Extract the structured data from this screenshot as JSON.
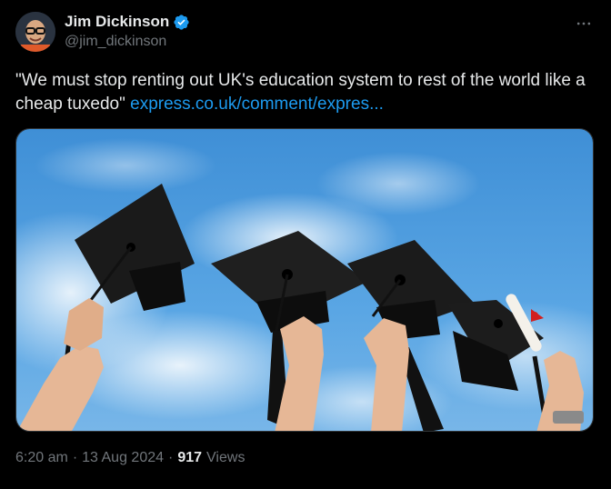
{
  "author": {
    "display_name": "Jim Dickinson",
    "handle": "@jim_dickinson",
    "verified": true
  },
  "tweet": {
    "text": "\"We must stop renting out UK's education system to rest of the world like a cheap tuxedo\" ",
    "link_text": "express.co.uk/comment/expres...",
    "media_description": "Graduation caps thrown against blue sky"
  },
  "meta": {
    "time": "6:20 am",
    "separator": "·",
    "date": "13 Aug 2024",
    "views_count": "917",
    "views_label": "Views"
  },
  "colors": {
    "background": "#000000",
    "text": "#e7e9ea",
    "secondary_text": "#71767b",
    "link": "#1d9bf0",
    "verified_badge": "#1d9bf0"
  },
  "icons": {
    "verified": "verified-badge-icon",
    "more": "more-horizontal-icon"
  }
}
